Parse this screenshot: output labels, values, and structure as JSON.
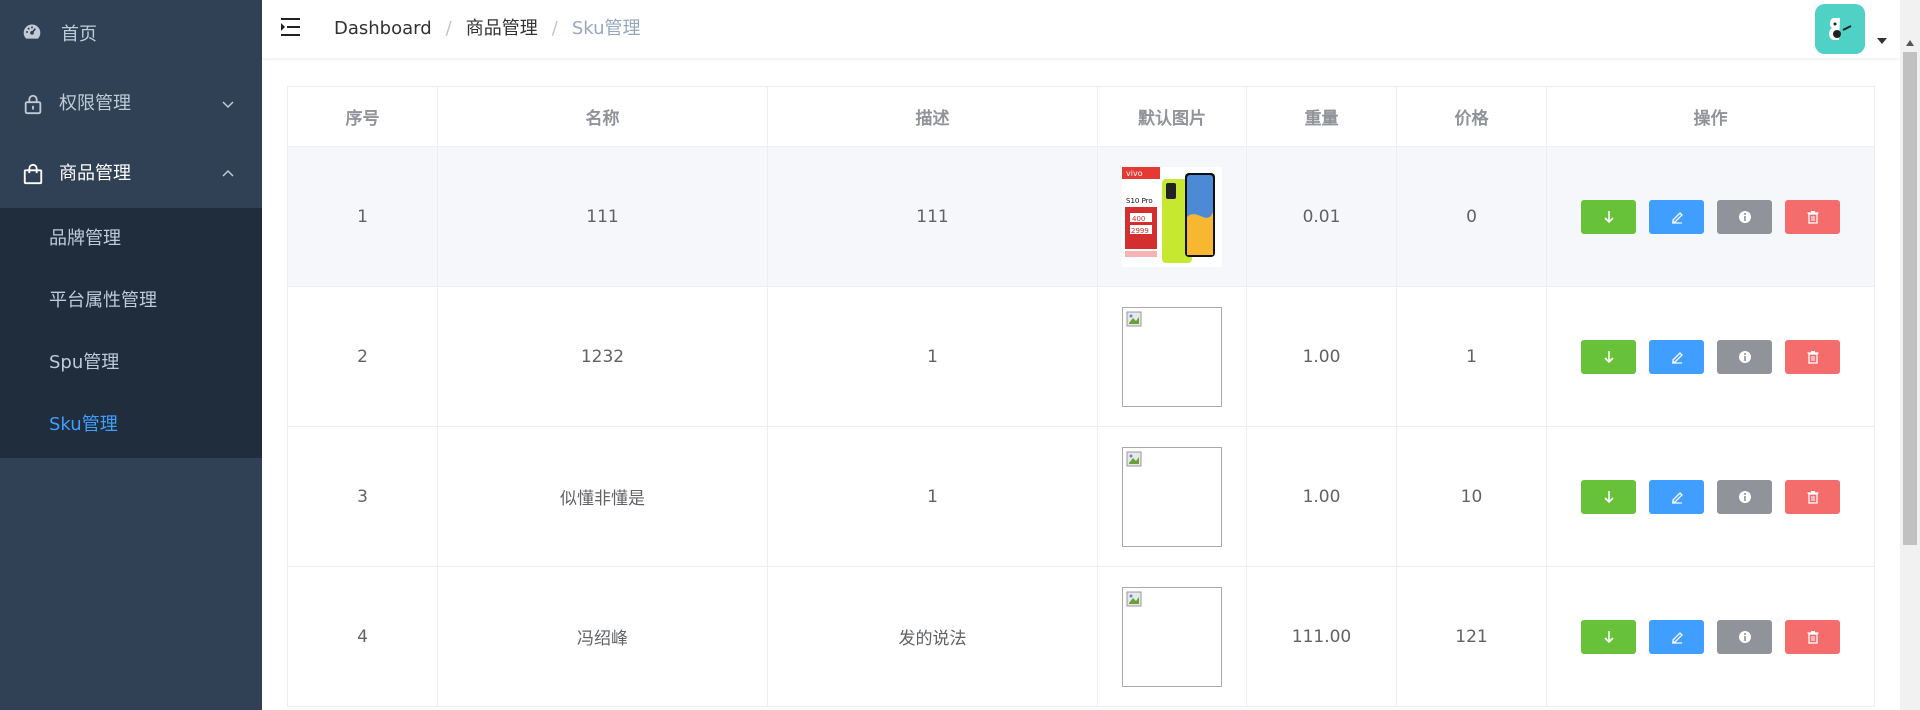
{
  "sidebar": {
    "items": [
      {
        "label": "首页",
        "icon": "dashboard-icon"
      },
      {
        "label": "权限管理",
        "icon": "lock-icon",
        "expanded": false
      },
      {
        "label": "商品管理",
        "icon": "shopping-bag-icon",
        "expanded": true
      }
    ],
    "submenu": [
      {
        "label": "品牌管理",
        "active": false
      },
      {
        "label": "平台属性管理",
        "active": false
      },
      {
        "label": "Spu管理",
        "active": false
      },
      {
        "label": "Sku管理",
        "active": true
      }
    ]
  },
  "header": {
    "breadcrumb": [
      "Dashboard",
      "商品管理",
      "Sku管理"
    ],
    "separator": "/"
  },
  "table": {
    "columns": [
      "序号",
      "名称",
      "描述",
      "默认图片",
      "重量",
      "价格",
      "操作"
    ],
    "rows": [
      {
        "index": "1",
        "name": "111",
        "desc": "111",
        "image": "vivo S10 Pro phone",
        "weight": "0.01",
        "price": "0"
      },
      {
        "index": "2",
        "name": "1232",
        "desc": "1",
        "image": "broken",
        "weight": "1.00",
        "price": "1"
      },
      {
        "index": "3",
        "name": "似懂非懂是",
        "desc": "1",
        "image": "broken",
        "weight": "1.00",
        "price": "10"
      },
      {
        "index": "4",
        "name": "冯绍峰",
        "desc": "发的说法",
        "image": "broken",
        "weight": "111.00",
        "price": "121"
      }
    ]
  },
  "promo_image": {
    "brand": "vivo",
    "model": "S10 Pro",
    "price": "2999",
    "discount": "400"
  },
  "colors": {
    "sidebar_bg": "#304156",
    "submenu_bg": "#1f2d3d",
    "active": "#409eff",
    "success": "#67c23a",
    "primary": "#409eff",
    "info": "#909399",
    "danger": "#f56c6c"
  }
}
